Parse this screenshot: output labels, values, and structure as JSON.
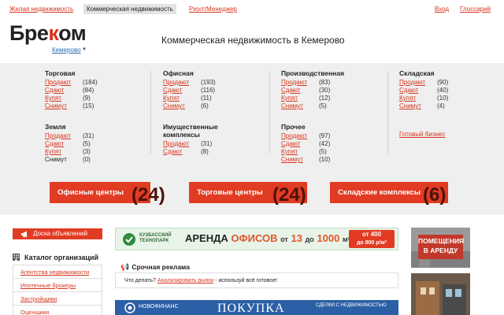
{
  "topnav": {
    "residential": "Жилая недвижимость",
    "commercial": "Коммерческая недвижимость",
    "realtor": "РиэлтМенеджер",
    "login": "Вход",
    "glossary": "Глоссарий"
  },
  "logo": {
    "part1": "Бре",
    "part2": "к",
    "part3": "ом"
  },
  "city": "Кемерово",
  "page_title": "Коммерческая недвижимость в Кемерово",
  "categories": {
    "trade": {
      "title": "Торговая",
      "rows": [
        {
          "label": "Продают",
          "count": "(184)"
        },
        {
          "label": "Сдают",
          "count": "(84)"
        },
        {
          "label": "Купят",
          "count": "(9)"
        },
        {
          "label": "Снимут",
          "count": "(15)"
        }
      ]
    },
    "office": {
      "title": "Офисная",
      "rows": [
        {
          "label": "Продают",
          "count": "(193)"
        },
        {
          "label": "Сдают",
          "count": "(116)"
        },
        {
          "label": "Купят",
          "count": "(11)"
        },
        {
          "label": "Снимут",
          "count": "(6)"
        }
      ]
    },
    "production": {
      "title": "Производственная",
      "rows": [
        {
          "label": "Продают",
          "count": "(83)"
        },
        {
          "label": "Сдают",
          "count": "(30)"
        },
        {
          "label": "Купят",
          "count": "(12)"
        },
        {
          "label": "Снимут",
          "count": "(5)"
        }
      ]
    },
    "warehouse": {
      "title": "Складская",
      "rows": [
        {
          "label": "Продают",
          "count": "(90)"
        },
        {
          "label": "Сдают",
          "count": "(40)"
        },
        {
          "label": "Купят",
          "count": "(10)"
        },
        {
          "label": "Снимут",
          "count": "(4)"
        }
      ]
    },
    "land": {
      "title": "Земля",
      "rows": [
        {
          "label": "Продают",
          "count": "(31)"
        },
        {
          "label": "Сдают",
          "count": "(5)"
        },
        {
          "label": "Купят",
          "count": "(3)"
        },
        {
          "label": "Снимут",
          "count": "(0)"
        }
      ]
    },
    "property": {
      "title_line1": "Имущественные",
      "title_line2": "комплексы",
      "rows": [
        {
          "label": "Продают",
          "count": "(31)"
        },
        {
          "label": "Сдают",
          "count": "(8)"
        }
      ]
    },
    "other": {
      "title": "Прочее",
      "rows": [
        {
          "label": "Продают",
          "count": "(97)"
        },
        {
          "label": "Сдают",
          "count": "(42)"
        },
        {
          "label": "Купят",
          "count": "(5)"
        },
        {
          "label": "Снимут",
          "count": "(10)"
        }
      ]
    },
    "ready_business": "Готовый бизнес"
  },
  "big_buttons": [
    {
      "label": "Офисные центры",
      "count": "(24)"
    },
    {
      "label": "Торговые центры",
      "count": "(24)"
    },
    {
      "label": "Складские комплексы",
      "count": "(6)"
    }
  ],
  "sidebar": {
    "board_button": "Доска объявлений",
    "catalog_title": "Каталог организаций",
    "items": [
      "Агентства недвижимости",
      "Ипотечные брокеры",
      "Застройщики",
      "Оценщики"
    ]
  },
  "banner1": {
    "brand_line1": "КУЗБАССКИЙ",
    "brand_line2": "ТЕХНОПАРК",
    "headline_a": "АРЕНДА",
    "headline_b": "ОФИСОВ",
    "from": "от",
    "from_value": "13",
    "to": "до",
    "to_value": "1000",
    "unit": "м²",
    "price_from": "от 400",
    "price_to": "до 800 р/м²"
  },
  "urgent": {
    "title": "Срочная реклама",
    "text_before": "Что делать? ",
    "link": "Анализировать рынок",
    "text_after": " - используй всё готовое!"
  },
  "banner2": {
    "brand": "НОВОФИНАНС",
    "headline": "ПОКУПКА",
    "sub": "СДЕЛКИ С НЕДВИЖИМОСТЬЮ"
  },
  "ad1": {
    "line1": "ПОМЕЩЕНИЯ",
    "line2": "В АРЕНДУ"
  },
  "colors": {
    "accent": "#e23b23",
    "link": "#d9341c",
    "panel": "#efefef"
  }
}
